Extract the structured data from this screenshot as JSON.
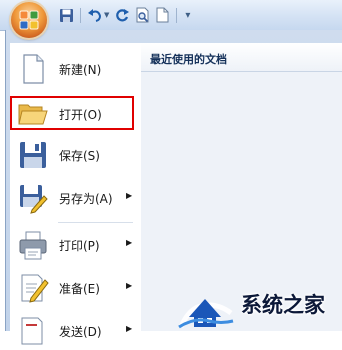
{
  "quick_access": {
    "items": [
      {
        "name": "save-icon"
      },
      {
        "name": "undo-icon"
      },
      {
        "name": "redo-icon"
      },
      {
        "name": "print-preview-icon"
      },
      {
        "name": "new-document-icon"
      }
    ],
    "more_glyph": "▾"
  },
  "menu": {
    "items": [
      {
        "label": "新建(N)",
        "icon": "new-document-icon",
        "submenu": false
      },
      {
        "label": "打开(O)",
        "icon": "open-folder-icon",
        "submenu": false,
        "highlighted": true
      },
      {
        "label": "保存(S)",
        "icon": "save-icon",
        "submenu": false
      },
      {
        "label": "另存为(A)",
        "icon": "save-as-icon",
        "submenu": true
      },
      {
        "label": "打印(P)",
        "icon": "printer-icon",
        "submenu": true
      },
      {
        "label": "准备(E)",
        "icon": "prepare-icon",
        "submenu": true
      },
      {
        "label": "发送(D)",
        "icon": "send-icon",
        "submenu": true
      }
    ],
    "arrow_glyph": "▶"
  },
  "recent": {
    "title": "最近使用的文档"
  },
  "watermark": {
    "text": "系统之家"
  },
  "colors": {
    "highlight_border": "#e00000",
    "menu_background": "#c2d3ea",
    "accent": "#15315a"
  }
}
